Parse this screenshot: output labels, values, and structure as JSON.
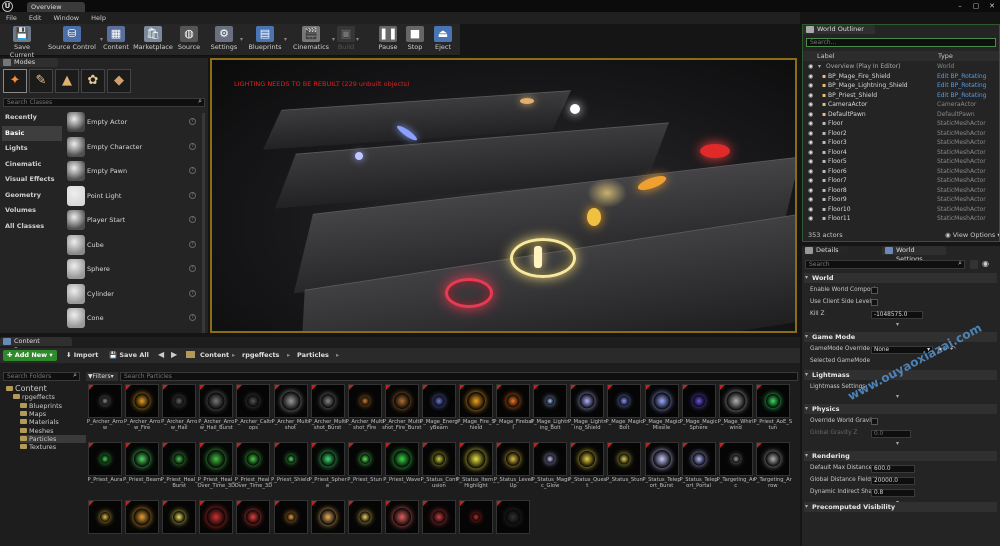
{
  "window": {
    "logo": "U",
    "doc_tab": "Overview",
    "controls": [
      "–",
      "▢",
      "✕"
    ]
  },
  "menu": [
    "File",
    "Edit",
    "Window",
    "Help"
  ],
  "toolbar": [
    {
      "label": "Save Current",
      "icon": "save-icon",
      "color": "#6c7a8a",
      "glyph": "💾",
      "dropdown": false,
      "enabled": true
    },
    {
      "label": "Source Control",
      "icon": "source-control-icon",
      "color": "#4a6ea5",
      "glyph": "⛁",
      "dropdown": true,
      "enabled": true
    },
    {
      "label": "Content",
      "icon": "content-icon",
      "color": "#5b6f9a",
      "glyph": "▦",
      "dropdown": false,
      "enabled": true
    },
    {
      "label": "Marketplace",
      "icon": "marketplace-icon",
      "color": "#7a8a9a",
      "glyph": "🛍",
      "dropdown": false,
      "enabled": true
    },
    {
      "label": "Source",
      "icon": "source-icon",
      "color": "#555",
      "glyph": "◍",
      "dropdown": false,
      "enabled": true
    },
    {
      "label": "Settings",
      "icon": "settings-icon",
      "color": "#6a7080",
      "glyph": "⚙",
      "dropdown": true,
      "enabled": true
    },
    {
      "label": "Blueprints",
      "icon": "blueprints-icon",
      "color": "#4a75b5",
      "glyph": "▤",
      "dropdown": true,
      "enabled": true
    },
    {
      "label": "Cinematics",
      "icon": "cinematics-icon",
      "color": "#777",
      "glyph": "🎬",
      "dropdown": true,
      "enabled": true
    },
    {
      "label": "Build",
      "icon": "build-icon",
      "color": "#555",
      "glyph": "▣",
      "dropdown": true,
      "enabled": false
    },
    {
      "label": "Pause",
      "icon": "pause-icon",
      "color": "#666",
      "glyph": "❚❚",
      "dropdown": false,
      "enabled": true
    },
    {
      "label": "Stop",
      "icon": "stop-icon",
      "color": "#666",
      "glyph": "■",
      "dropdown": false,
      "enabled": true
    },
    {
      "label": "Eject",
      "icon": "eject-icon",
      "color": "#4a75b5",
      "glyph": "⏏",
      "dropdown": false,
      "enabled": true
    }
  ],
  "modes": {
    "tab": "Modes",
    "icons": [
      "place-mode-icon",
      "paint-mode-icon",
      "landscape-mode-icon",
      "foliage-mode-icon",
      "geometry-mode-icon"
    ],
    "search_placeholder": "Search Classes",
    "categories": [
      "Recently Placed",
      "Basic",
      "Lights",
      "Cinematic",
      "Visual Effects",
      "Geometry",
      "Volumes",
      "All Classes"
    ],
    "selected_category": "Basic",
    "actors": [
      "Empty Actor",
      "Empty Character",
      "Empty Pawn",
      "Point Light",
      "Player Start",
      "Cube",
      "Sphere",
      "Cylinder",
      "Cone"
    ]
  },
  "viewport": {
    "warning": "LIGHTING NEEDS TO BE REBUILT (229 unbuilt objects)"
  },
  "outliner": {
    "tab": "World Outliner",
    "search_placeholder": "Search...",
    "columns": [
      "Label",
      "Type"
    ],
    "rows": [
      {
        "label": "Overview (Play In Editor)",
        "type": "World",
        "link": false
      },
      {
        "label": "BP_Mage_Fire_Shield",
        "type": "Edit BP_Rotating",
        "link": true
      },
      {
        "label": "BP_Mage_Lightning_Shield",
        "type": "Edit BP_Rotating",
        "link": true
      },
      {
        "label": "BP_Priest_Shield",
        "type": "Edit BP_Rotating",
        "link": true
      },
      {
        "label": "CameraActor",
        "type": "CameraActor",
        "link": false
      },
      {
        "label": "DefaultPawn",
        "type": "DefaultPawn",
        "link": false
      },
      {
        "label": "Floor",
        "type": "StaticMeshActor",
        "link": false
      },
      {
        "label": "Floor2",
        "type": "StaticMeshActor",
        "link": false
      },
      {
        "label": "Floor3",
        "type": "StaticMeshActor",
        "link": false
      },
      {
        "label": "Floor4",
        "type": "StaticMeshActor",
        "link": false
      },
      {
        "label": "Floor5",
        "type": "StaticMeshActor",
        "link": false
      },
      {
        "label": "Floor6",
        "type": "StaticMeshActor",
        "link": false
      },
      {
        "label": "Floor7",
        "type": "StaticMeshActor",
        "link": false
      },
      {
        "label": "Floor8",
        "type": "StaticMeshActor",
        "link": false
      },
      {
        "label": "Floor9",
        "type": "StaticMeshActor",
        "link": false
      },
      {
        "label": "Floor10",
        "type": "StaticMeshActor",
        "link": false
      },
      {
        "label": "Floor11",
        "type": "StaticMeshActor",
        "link": false
      }
    ],
    "count": "353 actors",
    "view_options": "View Options"
  },
  "details": {
    "tabs": [
      "Details",
      "World Settings"
    ],
    "search_placeholder": "Search",
    "sections": {
      "world": "World",
      "game_mode": "Game Mode",
      "lightmass": "Lightmass",
      "physics": "Physics",
      "rendering": "Rendering",
      "precomputed": "Precomputed Visibility"
    },
    "props": {
      "enable_world_comp": "Enable World Composi",
      "use_client_side": "Use Client Side Level",
      "kill_z": "Kill Z",
      "kill_z_val": "-1048575.0",
      "gamemode_override": "GameMode Override",
      "gamemode_val": "None",
      "selected_gamemode": "Selected GameMode",
      "lightmass_settings": "Lightmass Settings",
      "override_gravity": "Override World Gravity",
      "global_gravity": "Global Gravity Z",
      "global_gravity_val": "0.0",
      "default_max_dist": "Default Max Distance",
      "default_max_dist_val": "600.0",
      "global_dist_field": "Global Distance Field V",
      "global_dist_field_val": "20000.0",
      "dynamic_indirect": "Dynamic Indirect Shac",
      "dynamic_indirect_val": "0.8"
    }
  },
  "content_browser": {
    "tab": "Content Browser",
    "add_new": "Add New",
    "import": "Import",
    "save_all": "Save All",
    "path": [
      "Content",
      "rpgeffects",
      "Particles"
    ],
    "search_folders": "Search Folders",
    "filters": "Filters",
    "search_assets": "Search Particles",
    "tree": [
      {
        "label": "Content",
        "indent": 0
      },
      {
        "label": "rpgeffects",
        "indent": 1
      },
      {
        "label": "Blueprints",
        "indent": 2
      },
      {
        "label": "Maps",
        "indent": 2
      },
      {
        "label": "Materials",
        "indent": 2
      },
      {
        "label": "Meshes",
        "indent": 2
      },
      {
        "label": "Particles",
        "indent": 2
      },
      {
        "label": "Textures",
        "indent": 2
      }
    ],
    "assets": [
      {
        "name": "P_Archer_Arrow",
        "fx": "#8a8a8a"
      },
      {
        "name": "P_Archer_Arrow_Fire",
        "fx": "#e8a020"
      },
      {
        "name": "P_Archer_Arrow_Hail",
        "fx": "#666"
      },
      {
        "name": "P_Archer_Arrow_Hail_Burst",
        "fx": "#777"
      },
      {
        "name": "P_Archer_Caltrops",
        "fx": "#555"
      },
      {
        "name": "P_Archer_Multishot",
        "fx": "#9a9a9a"
      },
      {
        "name": "P_Archer_Multishot_Burst",
        "fx": "#888"
      },
      {
        "name": "P_Archer_Multishot_Fire",
        "fx": "#d08030"
      },
      {
        "name": "P_Archer_Multishot_Fire_Burst",
        "fx": "#b07030"
      },
      {
        "name": "P_Mage_EnergyBeam",
        "fx": "#6a7ad8"
      },
      {
        "name": "P_Mage_Fire_Shield",
        "fx": "#f0a020"
      },
      {
        "name": "P_Mage_Fireball",
        "fx": "#f07820"
      },
      {
        "name": "P_Mage_Lightning_Bolt",
        "fx": "#a8c8ff"
      },
      {
        "name": "P_Mage_Lightning_Shield",
        "fx": "#b0b0ff"
      },
      {
        "name": "P_Mage_MagicBolt",
        "fx": "#8a9aff"
      },
      {
        "name": "P_Mage_MagicMissile",
        "fx": "#9aa8ff"
      },
      {
        "name": "P_Mage_MagicSphere",
        "fx": "#6a58e8"
      },
      {
        "name": "P_Mage_Whirlwind",
        "fx": "#b0b0b0"
      },
      {
        "name": "P_Priest_AoE_Stun",
        "fx": "#38e060"
      },
      {
        "name": "P_Priest_Aura",
        "fx": "#40d050"
      },
      {
        "name": "P_Priest_Beam",
        "fx": "#50d860"
      },
      {
        "name": "P_Priest_Heal_Burst",
        "fx": "#48c850"
      },
      {
        "name": "P_Priest_Heal_Over_Time_3D",
        "fx": "#40c040"
      },
      {
        "name": "P_Priest_Heal_Over_Time_3D",
        "fx": "#48d048"
      },
      {
        "name": "P_Priest_Shield",
        "fx": "#50e060"
      },
      {
        "name": "P_Priest_Sphere",
        "fx": "#40e070"
      },
      {
        "name": "P_Priest_Stun",
        "fx": "#58e858"
      },
      {
        "name": "P_Priest_Wave",
        "fx": "#38d848"
      },
      {
        "name": "P_Status_Confusion",
        "fx": "#d0d040"
      },
      {
        "name": "P_Status_Item_Highlight",
        "fx": "#e8e040"
      },
      {
        "name": "P_Status_LevelUp",
        "fx": "#e0c040"
      },
      {
        "name": "P_Status_Magic_Glow",
        "fx": "#c8c8ff"
      },
      {
        "name": "P_Status_Quest",
        "fx": "#e8d040"
      },
      {
        "name": "P_Status_Stun",
        "fx": "#e0d050"
      },
      {
        "name": "P_Status_Teleport_Burst",
        "fx": "#c8c8ff"
      },
      {
        "name": "P_Status_Teleport_Portal",
        "fx": "#b8b8ff"
      },
      {
        "name": "P_Targeting_Arc",
        "fx": "#a0a0a0"
      },
      {
        "name": "P_Targeting_Arrow",
        "fx": "#b0b0b0"
      },
      {
        "name": "",
        "fx": "#e8c040"
      },
      {
        "name": "",
        "fx": "#e8a030"
      },
      {
        "name": "",
        "fx": "#f0e060"
      },
      {
        "name": "",
        "fx": "#d03030"
      },
      {
        "name": "",
        "fx": "#e84040"
      },
      {
        "name": "",
        "fx": "#f0a040"
      },
      {
        "name": "",
        "fx": "#e8b060"
      },
      {
        "name": "",
        "fx": "#f0d060"
      },
      {
        "name": "",
        "fx": "#e06060"
      },
      {
        "name": "",
        "fx": "#d04040"
      },
      {
        "name": "",
        "fx": "#c83030"
      },
      {
        "name": "",
        "fx": "#333"
      }
    ]
  },
  "watermark": "www.ouyaoxiazai.com"
}
